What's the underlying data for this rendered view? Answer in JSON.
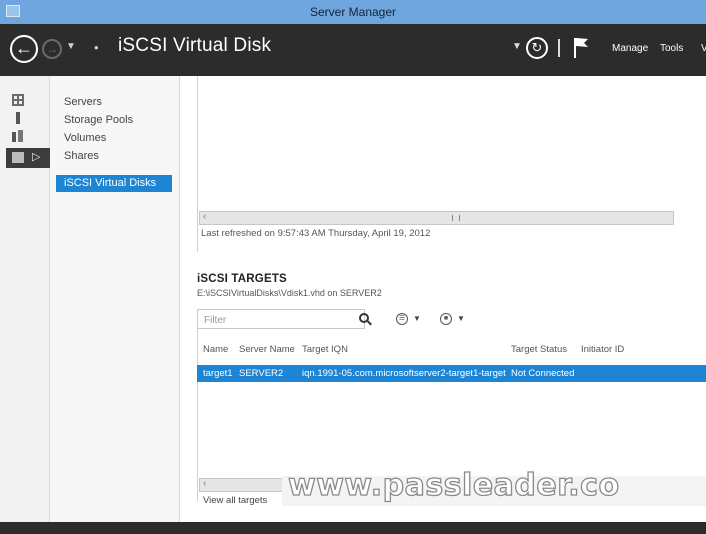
{
  "window": {
    "title": "Server Manager"
  },
  "header": {
    "breadcrumb_sep": "•",
    "title": "iSCSI Virtual Disk",
    "menus": [
      "Manage",
      "Tools",
      "V"
    ]
  },
  "sidebar": {
    "items": [
      {
        "label": "Servers"
      },
      {
        "label": "Storage Pools"
      },
      {
        "label": "Volumes"
      },
      {
        "label": "Shares"
      },
      {
        "label": "iSCSI Virtual Disks",
        "active": true
      }
    ]
  },
  "upper_pane": {
    "last_refreshed": "Last refreshed on 9:57:43 AM Thursday, April 19, 2012"
  },
  "targets": {
    "title": "iSCSI TARGETS",
    "subtitle": "E:\\iSCSIVirtualDisks\\Vdisk1.vhd on SERVER2",
    "filter_placeholder": "Filter",
    "columns": [
      "Name",
      "Server Name",
      "Target IQN",
      "Target Status",
      "Initiator ID"
    ],
    "rows": [
      {
        "name": "target1",
        "server": "SERVER2",
        "iqn": "iqn.1991-05.com.microsoftserver2-target1-target",
        "status": "Not Connected",
        "initiator": ""
      }
    ],
    "view_all": "View all targets"
  },
  "watermark": "www.passleader.co",
  "colors": {
    "titlebar": "#6fa6dd",
    "header": "#2c2c2c",
    "selection": "#1e84d4"
  }
}
